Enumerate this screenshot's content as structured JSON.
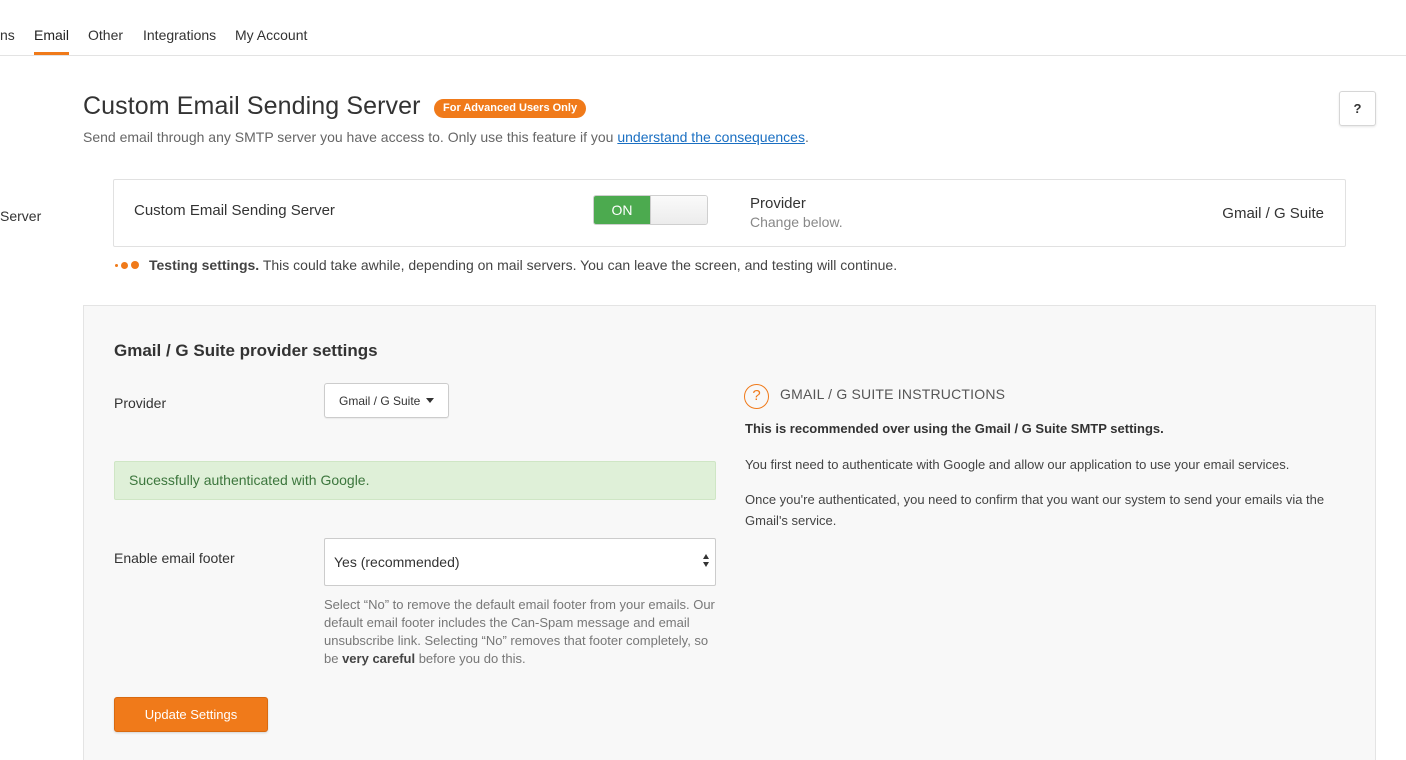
{
  "nav": {
    "tabs": [
      "ns",
      "Email",
      "Other",
      "Integrations",
      "My Account"
    ],
    "active": "Email"
  },
  "header": {
    "title": "Custom Email Sending Server",
    "badge": "For Advanced Users Only",
    "help_label": "?",
    "subtitle_prefix": "Send email through any SMTP server you have access to. Only use this feature if you ",
    "subtitle_link": "understand the consequences",
    "subtitle_suffix": "."
  },
  "side_label": "Server",
  "server_card": {
    "label": "Custom Email Sending Server",
    "toggle_label": "ON",
    "toggle_on": true,
    "provider_title": "Provider",
    "provider_sub": "Change below.",
    "provider_value": "Gmail / G Suite"
  },
  "testing": {
    "bold": "Testing settings.",
    "text": " This could take awhile, depending on mail servers. You can leave the screen, and testing will continue."
  },
  "panel": {
    "title": "Gmail / G Suite provider settings",
    "provider_label": "Provider",
    "provider_value": "Gmail / G Suite",
    "success_alert": "Sucessfully authenticated with Google.",
    "footer_label": "Enable email footer",
    "footer_value": "Yes (recommended)",
    "help_part1": "Select “No” to remove the default email footer from your emails. Our default email footer includes the Can-Spam message and email unsubscribe link. Selecting “No” removes that footer completely, so be ",
    "help_bold": "very careful",
    "help_part2": " before you do this.",
    "update_button": "Update Settings"
  },
  "instructions": {
    "icon_glyph": "?",
    "heading": "GMAIL / G SUITE INSTRUCTIONS",
    "bold_line": "This is recommended over using the Gmail / G Suite SMTP settings.",
    "para1": "You first need to authenticate with Google and allow our application to use your email services.",
    "para2": "Once you're authenticated, you need to confirm that you want our system to send your emails via the Gmail's service."
  },
  "colors": {
    "accent": "#f07a1a",
    "toggle_on": "#4caa4f",
    "link": "#1a6fc2",
    "success_bg": "#dff0d8",
    "success_text": "#3c763d"
  }
}
